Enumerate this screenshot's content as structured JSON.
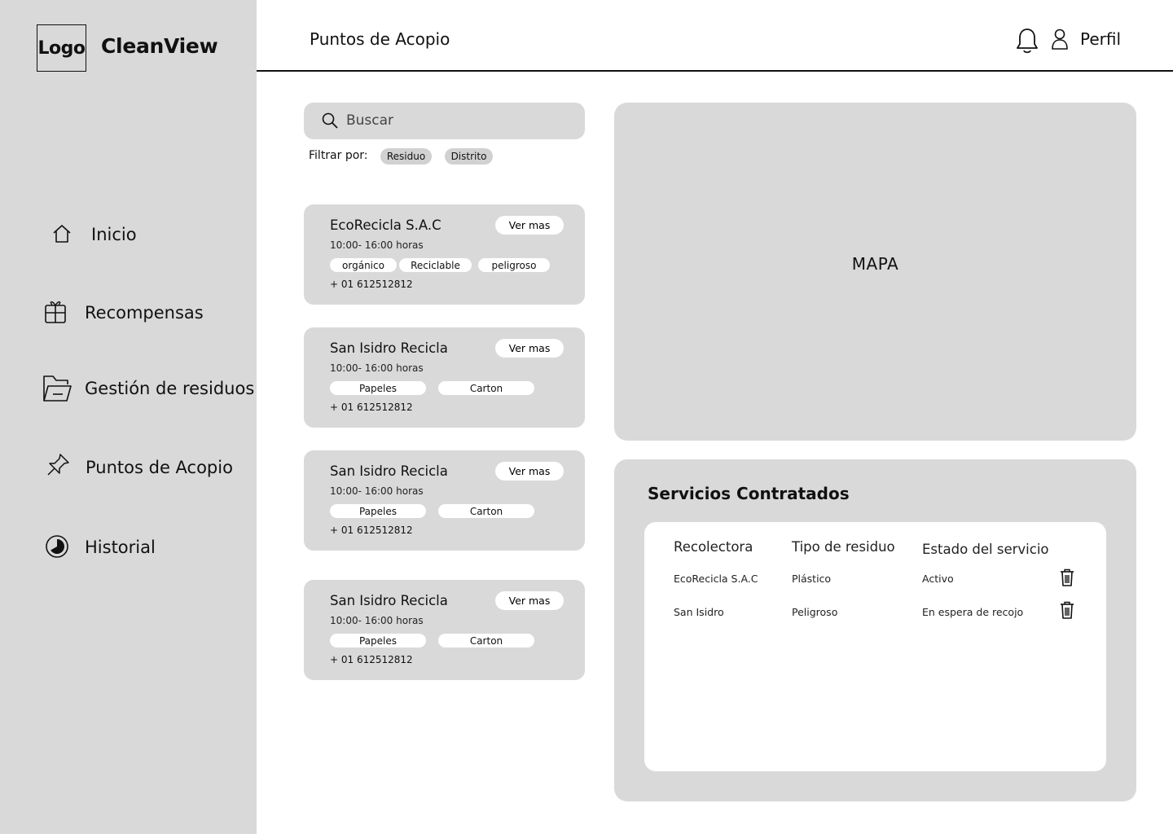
{
  "sidebar": {
    "logo": "Logo",
    "brand": "CleanView",
    "items": [
      {
        "label": "Inicio",
        "icon": "home-icon"
      },
      {
        "label": "Recompensas",
        "icon": "gift-icon"
      },
      {
        "label": "Gestión de residuos",
        "icon": "folder-icon"
      },
      {
        "label": "Puntos de Acopio",
        "icon": "pin-icon"
      },
      {
        "label": "Historial",
        "icon": "history-icon"
      }
    ]
  },
  "header": {
    "title": "Puntos de Acopio",
    "profile_label": "Perfil",
    "notification_icon": "bell-icon",
    "profile_icon": "user-icon"
  },
  "search": {
    "placeholder": "Buscar",
    "value": ""
  },
  "filters": {
    "label": "Filtrar por:",
    "options": [
      "Residuo",
      "Distrito"
    ]
  },
  "cards": [
    {
      "name": "EcoRecicla S.A.C",
      "button": "Ver mas",
      "hours": "10:00- 16:00 horas",
      "tags": [
        "orgánico",
        "Reciclable",
        "peligroso"
      ],
      "phone": "+ 01 612512812"
    },
    {
      "name": "San Isidro Recicla",
      "button": "Ver mas",
      "hours": "10:00- 16:00 horas",
      "tags": [
        "Papeles",
        "Carton"
      ],
      "phone": "+ 01 612512812"
    },
    {
      "name": "San Isidro Recicla",
      "button": "Ver mas",
      "hours": "10:00- 16:00 horas",
      "tags": [
        "Papeles",
        "Carton"
      ],
      "phone": "+ 01 612512812"
    },
    {
      "name": "San Isidro Recicla",
      "button": "Ver mas",
      "hours": "10:00- 16:00 horas",
      "tags": [
        "Papeles",
        "Carton"
      ],
      "phone": "+ 01 612512812"
    }
  ],
  "map": {
    "label": "MAPA"
  },
  "services": {
    "title": "Servicios Contratados",
    "columns": [
      "Recolectora",
      "Tipo de residuo",
      "Estado del servicio"
    ],
    "rows": [
      {
        "collector": "EcoRecicla S.A.C",
        "waste_type": "Plástico",
        "status": "Activo"
      },
      {
        "collector": "San Isidro",
        "waste_type": "Peligroso",
        "status": "En espera de recojo"
      }
    ],
    "delete_icon": "trash-icon"
  },
  "colors": {
    "panel": "#d9d9d9",
    "white": "#ffffff",
    "text": "#111111"
  }
}
